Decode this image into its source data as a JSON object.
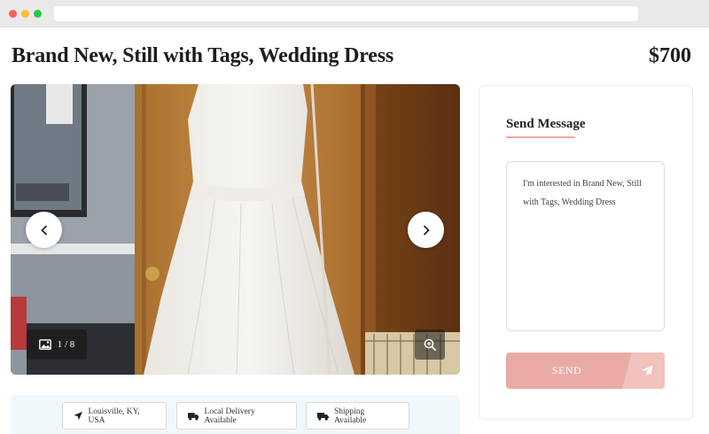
{
  "listing": {
    "title": "Brand New, Still with Tags, Wedding Dress",
    "price": "$700"
  },
  "gallery": {
    "counter": "1 / 8",
    "image_icon": "image-icon",
    "zoom_icon": "zoom-in-icon",
    "prev_icon": "chevron-left-icon",
    "next_icon": "chevron-right-icon"
  },
  "info_chips": {
    "location": "Louisville, KY, USA",
    "local_delivery": "Local Delivery Available",
    "shipping": "Shipping Available",
    "location_icon": "location-arrow-icon",
    "truck_icon": "truck-icon"
  },
  "message_card": {
    "title": "Send Message",
    "message_text": "I'm interested in Brand New, Still with Tags, Wedding Dress",
    "send_label": "SEND",
    "send_icon": "paper-plane-icon"
  },
  "colors": {
    "accent": "#eaaba6",
    "accent_light": "#f1c2be",
    "underline": "#f2a5a2",
    "chip_strip": "#f1f8fb"
  }
}
